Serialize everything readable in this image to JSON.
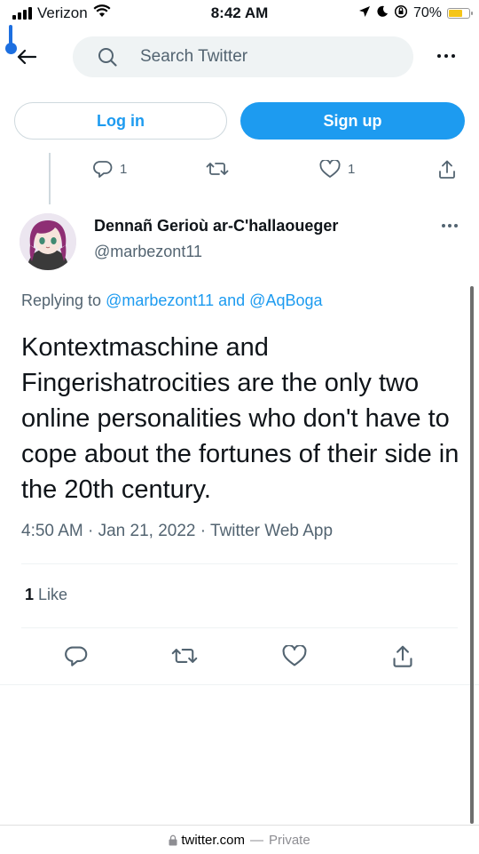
{
  "status_bar": {
    "carrier": "Verizon",
    "time": "8:42 AM",
    "battery": "70%",
    "battery_level": 0.7
  },
  "header": {
    "back_icon": "arrow-left-icon",
    "search_placeholder": "Search Twitter",
    "more_icon": "more-dots-icon"
  },
  "auth": {
    "login_label": "Log in",
    "signup_label": "Sign up"
  },
  "parent_tweet_actions": {
    "reply_count": "1",
    "retweet_count": "",
    "like_count": "1"
  },
  "tweet": {
    "display_name": "Dennañ Gerioù ar-C'hallaoueger",
    "handle": "@marbezont11",
    "replying_prefix": "Replying to",
    "mention_1": "@marbezont11",
    "replying_and": "and",
    "mention_2": "@AqBoga",
    "text": "Kontextmaschine and Fingerishatrocities are the only two online personalities who don't have to cope about the fortunes of their side in the 20th century.",
    "time": "4:50 AM",
    "date": "Jan 21, 2022",
    "source": "Twitter Web App",
    "like_count": "1",
    "like_label": "Like"
  },
  "browser": {
    "domain": "twitter.com",
    "mode": "Private"
  },
  "colors": {
    "accent": "#1d9bf0",
    "text_primary": "#0f1419",
    "text_secondary": "#536471"
  }
}
